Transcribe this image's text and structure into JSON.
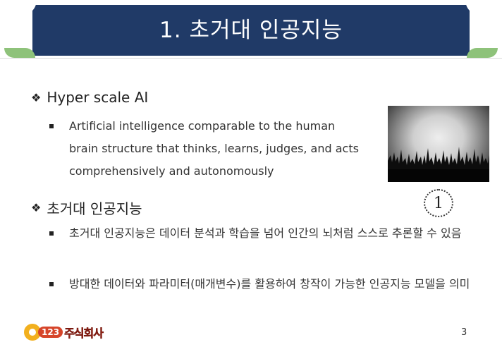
{
  "header": {
    "title": "1. 초거대 인공지능"
  },
  "sections": [
    {
      "heading": "Hyper scale AI",
      "bullets": [
        "Artificial intelligence comparable to the human brain structure that thinks, learns, judges, and acts comprehensively and autonomously"
      ]
    },
    {
      "heading": "초거대 인공지능",
      "bullets": [
        "초거대 인공지능은 데이터 분석과 학습을 넘어 인간의 뇌처럼 스스로 추론할 수 있음",
        "방대한 데이터와 파라미터(매개변수)를 활용하여 창작이 가능한 인공지능 모델을 의미"
      ]
    }
  ],
  "figure": {
    "marker": "1"
  },
  "footer": {
    "logo_number": "123",
    "logo_text": "주식회사",
    "page_number": "3"
  },
  "colors": {
    "header_bg": "#203a67",
    "accent_leaf": "#8ec27a",
    "logo_red": "#e23a2a",
    "logo_gold": "#f2b01e"
  },
  "icons": [
    "diamond-bullet-icon",
    "square-bullet-icon",
    "circled-number-icon"
  ]
}
